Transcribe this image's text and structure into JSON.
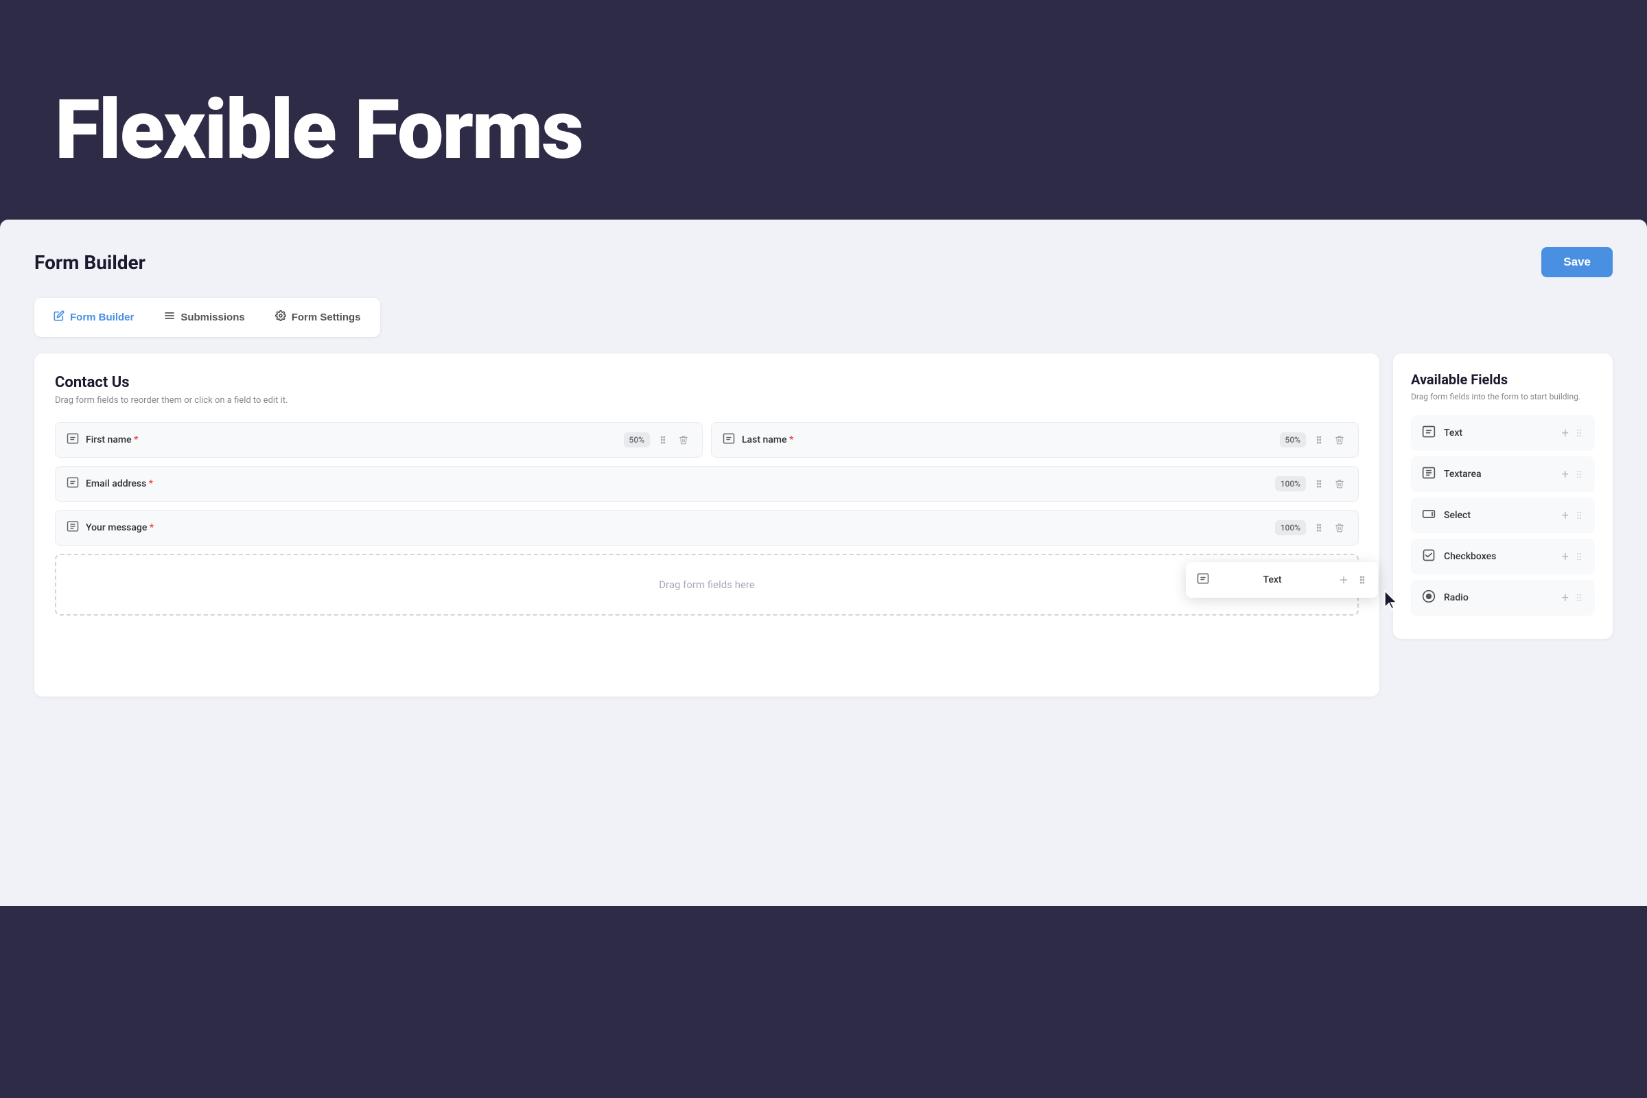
{
  "hero": {
    "title": "Flexible Forms",
    "bg_color": "#2d2b45"
  },
  "app": {
    "title": "Form Builder",
    "save_button": "Save"
  },
  "tabs": [
    {
      "id": "form-builder",
      "label": "Form Builder",
      "active": true,
      "icon": "edit"
    },
    {
      "id": "submissions",
      "label": "Submissions",
      "active": false,
      "icon": "list"
    },
    {
      "id": "form-settings",
      "label": "Form Settings",
      "active": false,
      "icon": "gear"
    }
  ],
  "form_panel": {
    "title": "Contact Us",
    "subtitle": "Drag form fields to reorder them or click on a field to edit it.",
    "drag_zone_text": "Drag form fields here",
    "floating_card": {
      "label": "Text",
      "icon": "text"
    }
  },
  "form_fields": [
    {
      "id": "first-name",
      "label": "First name",
      "required": true,
      "width": "50%",
      "icon": "text",
      "row": 1
    },
    {
      "id": "last-name",
      "label": "Last name",
      "required": true,
      "width": "50%",
      "icon": "text",
      "row": 1
    },
    {
      "id": "email-address",
      "label": "Email address",
      "required": true,
      "width": "100%",
      "icon": "text",
      "row": 2
    },
    {
      "id": "your-message",
      "label": "Your message",
      "required": true,
      "width": "100%",
      "icon": "textarea",
      "row": 3
    }
  ],
  "available_fields": [
    {
      "id": "text",
      "label": "Text",
      "icon": "text"
    },
    {
      "id": "textarea",
      "label": "Textarea",
      "icon": "textarea"
    },
    {
      "id": "select",
      "label": "Select",
      "icon": "select"
    },
    {
      "id": "checkboxes",
      "label": "Checkboxes",
      "icon": "checkbox"
    },
    {
      "id": "radio",
      "label": "Radio",
      "icon": "radio"
    }
  ],
  "available_fields_panel": {
    "title": "Available Fields",
    "subtitle": "Drag form fields into the form to start building."
  }
}
